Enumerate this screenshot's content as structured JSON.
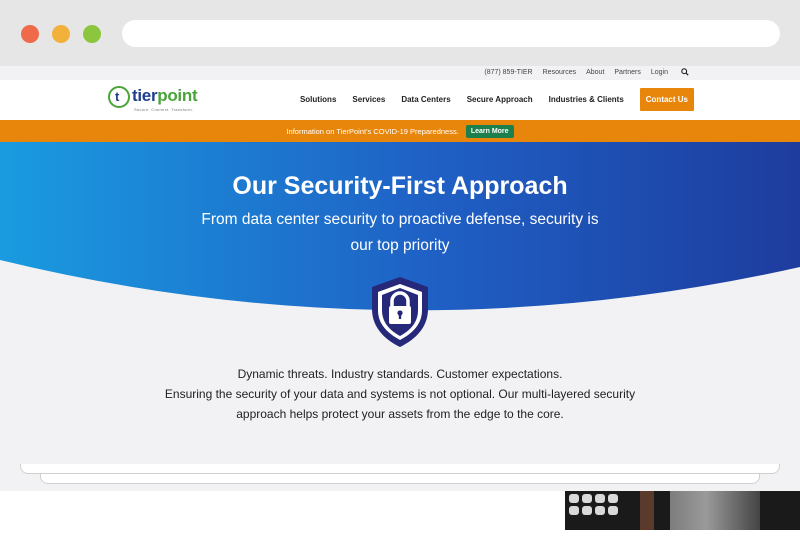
{
  "utility": {
    "phone": "(877) 859-TIER",
    "links": [
      "Resources",
      "About",
      "Partners",
      "Login"
    ]
  },
  "logo": {
    "mark": "t",
    "word_tier": "tier",
    "word_point": "point",
    "tagline": "Secure. Connect. Transform."
  },
  "nav": {
    "items": [
      "Solutions",
      "Services",
      "Data Centers",
      "Secure Approach",
      "Industries & Clients"
    ],
    "cta": "Contact Us"
  },
  "banner": {
    "text": "Information on TierPoint's COVID-19 Preparedness.",
    "button": "Learn More"
  },
  "hero": {
    "title": "Our Security-First Approach",
    "subtitle": "From data center security to proactive defense, security is our top priority"
  },
  "body": {
    "line1": "Dynamic threats. Industry standards. Customer expectations.",
    "line2": "Ensuring the security of your data and systems is not optional. Our multi-layered security approach helps protect your assets from the edge to the core."
  },
  "colors": {
    "brand_green": "#4aa43a",
    "brand_navy": "#1f3e8c",
    "orange": "#e8860c",
    "learn_green": "#1b7f4e",
    "hero_blue_left": "#1a9be0",
    "hero_blue_right": "#1e3c9e"
  },
  "icons": [
    "search-icon",
    "lock-shield-icon"
  ]
}
